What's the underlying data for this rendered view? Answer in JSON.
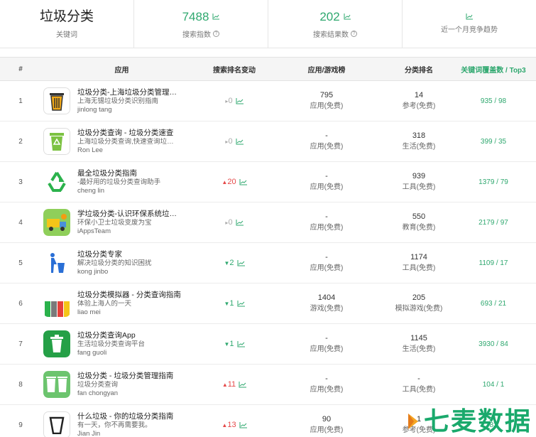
{
  "summary": {
    "keyword": "垃圾分类",
    "keyword_label": "关键词",
    "search_index": "7488",
    "search_index_label": "搜索指数",
    "search_results": "202",
    "search_results_label": "搜索结果数",
    "trend_label": "近一个月竞争趋势"
  },
  "table": {
    "headers": {
      "rank": "#",
      "app": "应用",
      "change": "搜索排名变动",
      "chart": "应用/游戏榜",
      "category": "分类排名",
      "keywords": "关键词覆盖数 / Top3"
    },
    "rows": [
      {
        "rank": "1",
        "name": "垃圾分类-上海垃圾分类管理…",
        "desc": "上海无锡垃圾分类识别指南",
        "dev": "jinlong tang",
        "change": "0",
        "dir": "zero",
        "chart_value": "795",
        "chart_label": "应用(免费)",
        "cat_value": "14",
        "cat_label": "参考(免费)",
        "keywords": "935 / 98",
        "icon": "trash-bin-icon"
      },
      {
        "rank": "2",
        "name": "垃圾分类查询 - 垃圾分类速查",
        "desc": "上海垃圾分类查询,快速查询垃…",
        "dev": "Ron Lee",
        "change": "0",
        "dir": "zero",
        "chart_value": "-",
        "chart_label": "应用(免费)",
        "cat_value": "318",
        "cat_label": "生活(免费)",
        "keywords": "399 / 35",
        "icon": "recycle-bin-icon"
      },
      {
        "rank": "3",
        "name": "最全垃圾分类指南",
        "desc": "-最好用的垃圾分类查询助手",
        "dev": "cheng lin",
        "change": "20",
        "dir": "up",
        "chart_value": "-",
        "chart_label": "应用(免费)",
        "cat_value": "939",
        "cat_label": "工具(免费)",
        "keywords": "1379 / 79",
        "icon": "recycle-arrows-icon"
      },
      {
        "rank": "4",
        "name": "学垃圾分类-认识环保系统垃…",
        "desc": "环保小卫士垃圾变废为宝",
        "dev": "iAppsTeam",
        "change": "0",
        "dir": "zero",
        "chart_value": "-",
        "chart_label": "应用(免费)",
        "cat_value": "550",
        "cat_label": "教育(免费)",
        "keywords": "2179 / 97",
        "icon": "garbage-truck-icon"
      },
      {
        "rank": "5",
        "name": "垃圾分类专家",
        "desc": "解决垃圾分类的知识困扰",
        "dev": "kong jinbo",
        "change": "2",
        "dir": "down",
        "chart_value": "-",
        "chart_label": "应用(免费)",
        "cat_value": "1174",
        "cat_label": "工具(免费)",
        "keywords": "1109 / 17",
        "icon": "person-bin-icon"
      },
      {
        "rank": "6",
        "name": "垃圾分类模拟器 - 分类查询指南",
        "desc": "体验上海人的一天",
        "dev": "liao mei",
        "change": "1",
        "dir": "down",
        "chart_value": "1404",
        "chart_label": "游戏(免费)",
        "cat_value": "205",
        "cat_label": "模拟游戏(免费)",
        "keywords": "693 / 21",
        "icon": "bins-row-icon"
      },
      {
        "rank": "7",
        "name": "垃圾分类查询App",
        "desc": "生活垃圾分类查询平台",
        "dev": "fang guoli",
        "change": "1",
        "dir": "down",
        "chart_value": "-",
        "chart_label": "应用(免费)",
        "cat_value": "1145",
        "cat_label": "生活(免费)",
        "keywords": "3930 / 84",
        "icon": "green-bin-icon"
      },
      {
        "rank": "8",
        "name": "垃圾分类 - 垃圾分类管理指南",
        "desc": "垃圾分类查询",
        "dev": "fan chongyan",
        "change": "11",
        "dir": "up",
        "chart_value": "-",
        "chart_label": "应用(免费)",
        "cat_value": "-",
        "cat_label": "工具(免费)",
        "keywords": "104 / 1",
        "icon": "twin-bins-icon"
      },
      {
        "rank": "9",
        "name": "什么垃圾 - 你的垃圾分类指南",
        "desc": "有一天，你不再需要我。",
        "dev": "Jian Jin",
        "change": "13",
        "dir": "up",
        "chart_value": "90",
        "chart_label": "应用(免费)",
        "cat_value": "1",
        "cat_label": "参考(免费)",
        "keywords": "83",
        "icon": "outline-bin-icon"
      }
    ]
  },
  "watermark": {
    "text": "七麦数据"
  },
  "colors": {
    "accent": "#2fa86f",
    "up": "#e54848",
    "zero": "#aaaaaa"
  }
}
